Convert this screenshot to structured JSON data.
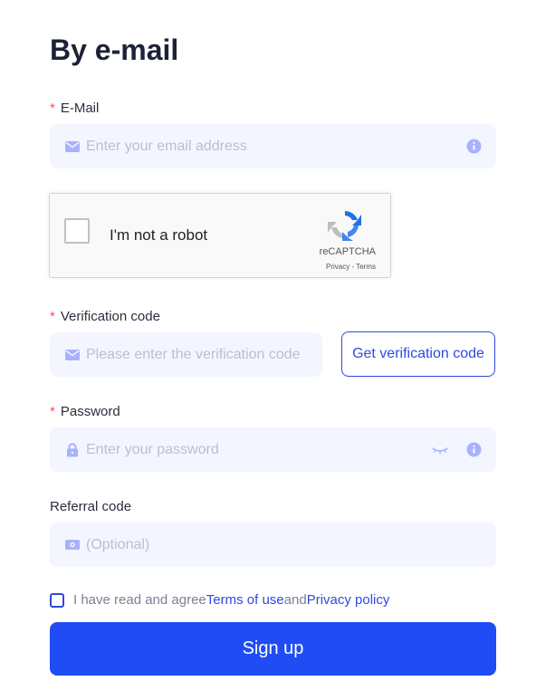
{
  "title": "By e-mail",
  "email": {
    "label": "E-Mail",
    "required_mark": "*",
    "placeholder": "Enter your email address",
    "value": "",
    "leading_icon": "mail-icon",
    "trailing_icon": "info-icon"
  },
  "recaptcha": {
    "label": "I'm not a robot",
    "brand": "reCAPTCHA",
    "terms": "Privacy - Terms",
    "icon": "recaptcha-icon"
  },
  "verification": {
    "label": "Verification code",
    "required_mark": "*",
    "placeholder": "Please enter the verification code",
    "value": "",
    "leading_icon": "mail-icon",
    "button_label": "Get verification code"
  },
  "password": {
    "label": "Password",
    "required_mark": "*",
    "placeholder": "Enter your password",
    "value": "",
    "leading_icon": "lock-icon",
    "visibility_icon": "eye-closed-icon",
    "trailing_icon": "info-icon"
  },
  "referral": {
    "label": "Referral code",
    "placeholder": "(Optional)",
    "value": "",
    "leading_icon": "referral-icon"
  },
  "agreement": {
    "prefix": "I have read and agree ",
    "terms_link": "Terms of use",
    "middle": " and ",
    "privacy_link": "Privacy policy",
    "checked": false
  },
  "signup": {
    "label": "Sign up"
  },
  "colors": {
    "accent": "#1f4cf4",
    "link": "#2f49df",
    "input_background": "#f4f6ff",
    "required": "#ff4d4f",
    "placeholder": "#b9bfd2",
    "icon_muted": "#a7b2ff"
  }
}
